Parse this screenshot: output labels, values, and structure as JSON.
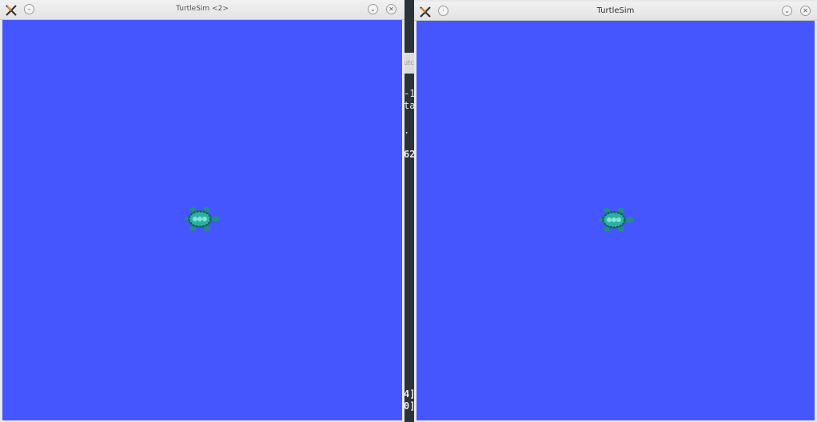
{
  "background_terminal": {
    "tab_text": "utc",
    "lines": [
      "-1",
      "ta",
      ".",
      "62",
      "4]",
      "0]"
    ]
  },
  "windows": [
    {
      "title": "TurtleSim <2>",
      "canvas_color": "#4556ff",
      "icons": [
        "app-logo-icon",
        "pin-icon",
        "minimize-icon",
        "close-icon"
      ]
    },
    {
      "title": "TurtleSim",
      "canvas_color": "#4556ff",
      "icons": [
        "app-logo-icon",
        "pin-icon",
        "minimize-icon",
        "close-icon"
      ]
    }
  ],
  "turtle": {
    "shell_color": "#2bb0a6",
    "body_color": "#1e8f86"
  }
}
